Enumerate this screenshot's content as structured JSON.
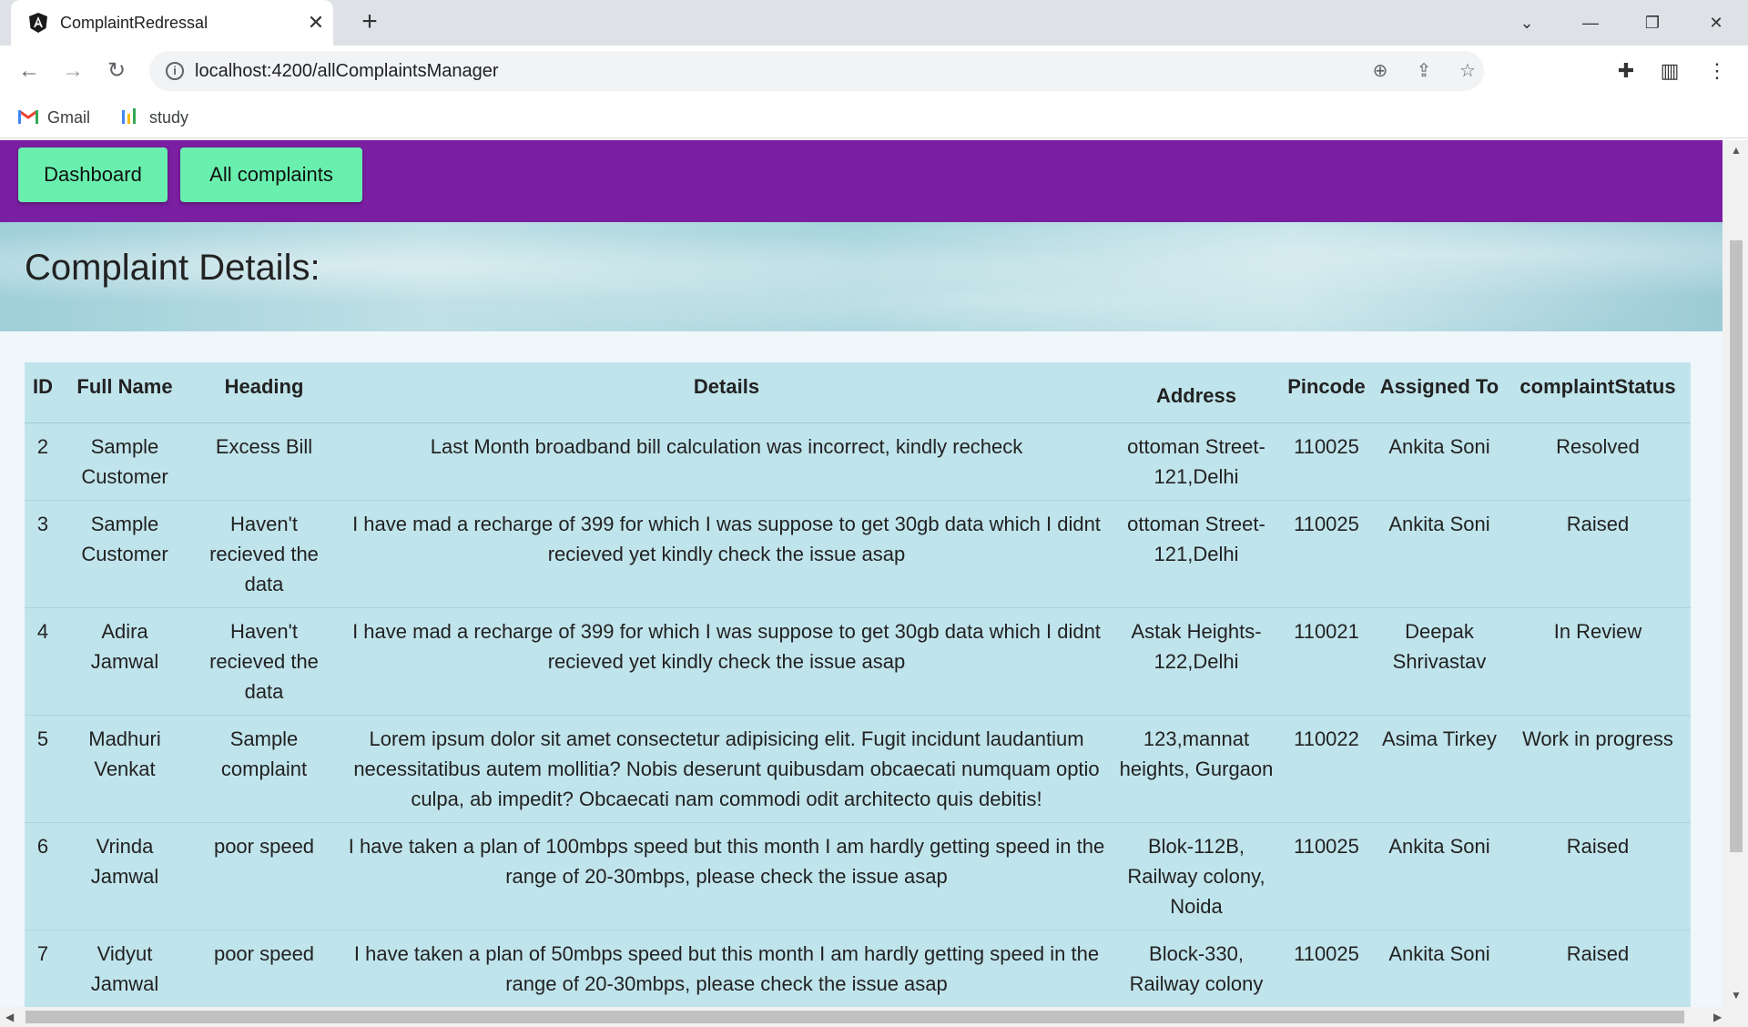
{
  "browser": {
    "tab_title": "ComplaintRedressal",
    "url": "localhost:4200/allComplaintsManager",
    "bookmarks": [
      {
        "label": "Gmail"
      },
      {
        "label": "study"
      }
    ]
  },
  "nav": {
    "dashboard_label": "Dashboard",
    "all_complaints_label": "All complaints",
    "accent_color": "#7b1fa2",
    "button_color": "#69f0ae"
  },
  "page": {
    "title": "Complaint Details:"
  },
  "table": {
    "headers": {
      "id": "ID",
      "full_name": "Full Name",
      "heading": "Heading",
      "details": "Details",
      "address": "Address",
      "pincode": "Pincode",
      "assigned_to": "Assigned To",
      "status": "complaintStatus"
    },
    "rows": [
      {
        "id": "2",
        "full_name": "Sample Customer",
        "heading": "Excess Bill",
        "details": "Last Month broadband bill calculation was incorrect, kindly recheck",
        "address": "ottoman Street-121,Delhi",
        "pincode": "110025",
        "assigned_to": "Ankita Soni",
        "status": "Resolved"
      },
      {
        "id": "3",
        "full_name": "Sample Customer",
        "heading": "Haven't recieved the data",
        "details": "I have mad a recharge of 399 for which I was suppose to get 30gb data which I didnt recieved yet kindly check the issue asap",
        "address": "ottoman Street-121,Delhi",
        "pincode": "110025",
        "assigned_to": "Ankita Soni",
        "status": "Raised"
      },
      {
        "id": "4",
        "full_name": "Adira Jamwal",
        "heading": "Haven't recieved the data",
        "details": "I have mad a recharge of 399 for which I was suppose to get 30gb data which I didnt recieved yet kindly check the issue asap",
        "address": "Astak Heights-122,Delhi",
        "pincode": "110021",
        "assigned_to": "Deepak Shrivastav",
        "status": "In Review"
      },
      {
        "id": "5",
        "full_name": "Madhuri Venkat",
        "heading": "Sample complaint",
        "details": "Lorem ipsum dolor sit amet consectetur adipisicing elit. Fugit incidunt laudantium necessitatibus autem mollitia? Nobis deserunt quibusdam obcaecati numquam optio culpa, ab impedit? Obcaecati nam commodi odit architecto quis debitis!",
        "address": "123,mannat heights, Gurgaon",
        "pincode": "110022",
        "assigned_to": "Asima Tirkey",
        "status": "Work in progress"
      },
      {
        "id": "6",
        "full_name": "Vrinda Jamwal",
        "heading": "poor speed",
        "details": "I have taken a plan of 100mbps speed but this month I am hardly getting speed in the range of 20-30mbps, please check the issue asap",
        "address": "Blok-112B, Railway colony, Noida",
        "pincode": "110025",
        "assigned_to": "Ankita Soni",
        "status": "Raised"
      },
      {
        "id": "7",
        "full_name": "Vidyut Jamwal",
        "heading": "poor speed",
        "details": "I have taken a plan of 50mbps speed but this month I am hardly getting speed in the range of 20-30mbps, please check the issue asap",
        "address": "Block-330, Railway colony",
        "pincode": "110025",
        "assigned_to": "Ankita Soni",
        "status": "Raised"
      }
    ]
  }
}
